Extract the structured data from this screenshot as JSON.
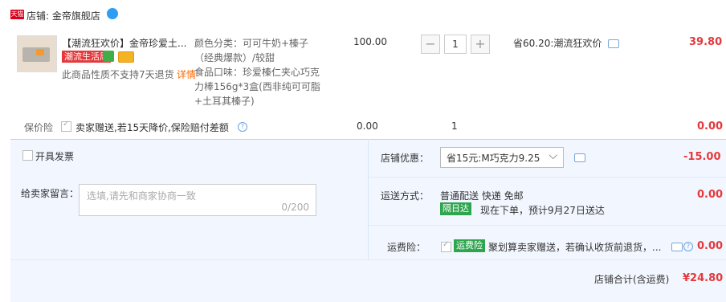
{
  "shop": {
    "badge": "天猫",
    "name": "店铺: 金帝旗舰店"
  },
  "item": {
    "title": "【潮流狂欢价】金帝珍爱土...",
    "promo_tag": "潮流生活周",
    "notice": "此商品性质不支持7天退货",
    "notice_link": "详情",
    "sku_line1": "颜色分类：可可牛奶+榛子",
    "sku_line2": "（经典爆款）/较甜",
    "sku_line3": "食品口味：珍爱榛仁夹心巧克",
    "sku_line4": "力棒156g*3盒(西非纯可可脂",
    "sku_line5": "+土耳其榛子)",
    "price": "100.00",
    "quantity": "1",
    "discount": "省60.20:潮流狂欢价",
    "subtotal": "39.80"
  },
  "service": {
    "label": "保价险",
    "text": "卖家赠送,若15天降价,保险赔付差额",
    "price": "0.00",
    "qty": "1",
    "total": "0.00"
  },
  "invoice": {
    "label": "开具发票"
  },
  "message": {
    "label": "给卖家留言：",
    "placeholder": "选填,请先和商家协商一致",
    "counter": "0/200"
  },
  "shop_discount": {
    "label": "店铺优惠：",
    "selected": "省15元:M巧克力9.25",
    "amount": "-15.00"
  },
  "delivery": {
    "label": "运送方式：",
    "method": "普通配送 快递 免邮",
    "tag": "隔日达",
    "eta": "现在下单，预计9月27日送达",
    "amount": "0.00"
  },
  "freight_ins": {
    "label": "运费险：",
    "tag": "运费险",
    "text": "聚划算卖家赠送，若确认收货前退货，...",
    "amount": "0.00"
  },
  "total": {
    "label": "店铺合计(含运费)",
    "amount": "¥24.80"
  },
  "colors": {
    "price_red": "#e4393c",
    "panel_blue": "#f2f7ff",
    "tag_green": "#2fa54f",
    "promo_red": "#e4393c"
  }
}
